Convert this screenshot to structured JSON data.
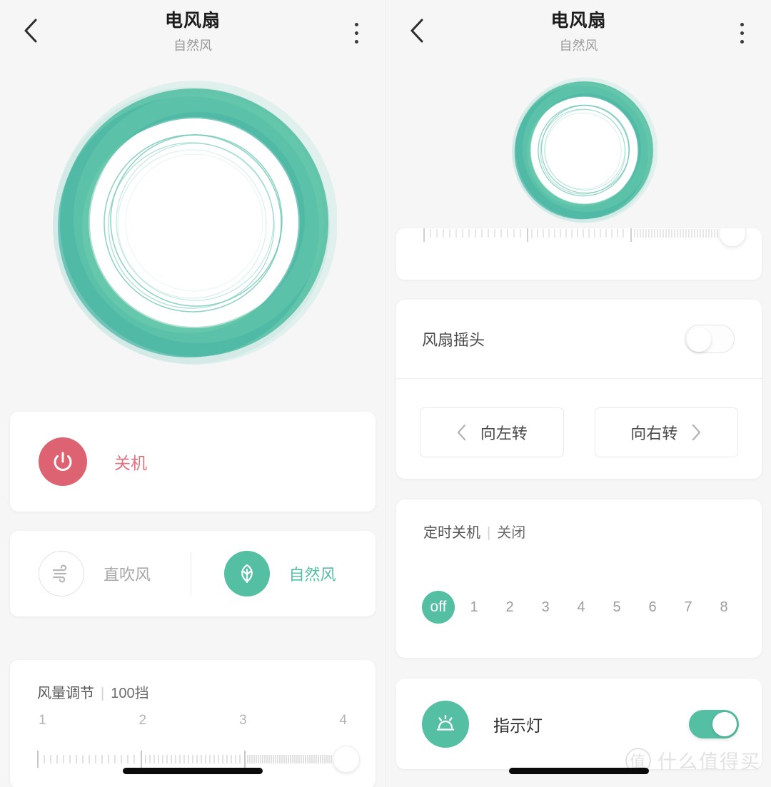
{
  "app": {
    "accent_color": "#55bfa4",
    "power_color": "#dd6272",
    "background": "#f6f6f6"
  },
  "header": {
    "title": "电风扇",
    "subtitle": "自然风",
    "back_icon": "chevron-left-icon",
    "menu_icon": "kebab-menu-icon"
  },
  "power_card": {
    "icon": "power-icon",
    "label": "关机"
  },
  "mode_card": {
    "options": [
      {
        "label": "直吹风",
        "icon": "wind-icon",
        "active": false
      },
      {
        "label": "自然风",
        "icon": "leaf-icon",
        "active": true
      }
    ]
  },
  "speed_card": {
    "title": "风量调节",
    "separator": "|",
    "value": "100挡",
    "scale_labels": [
      "1",
      "2",
      "3",
      "4"
    ],
    "knob_position": "right"
  },
  "oscillation_card": {
    "label": "风扇摇头",
    "toggle_state": "off",
    "buttons": [
      {
        "label": "向左转",
        "icon": "chevron-left-icon",
        "icon_side": "left"
      },
      {
        "label": "向右转",
        "icon": "chevron-right-icon",
        "icon_side": "right"
      }
    ]
  },
  "timer_card": {
    "title": "定时关机",
    "separator": "|",
    "value": "关闭",
    "options": [
      "off",
      "1",
      "2",
      "3",
      "4",
      "5",
      "6",
      "7",
      "8"
    ],
    "selected": "off"
  },
  "light_card": {
    "icon": "indicator-light-icon",
    "label": "指示灯",
    "toggle_state": "on"
  },
  "watermark": {
    "mark": "值",
    "text": "什么值得买"
  }
}
